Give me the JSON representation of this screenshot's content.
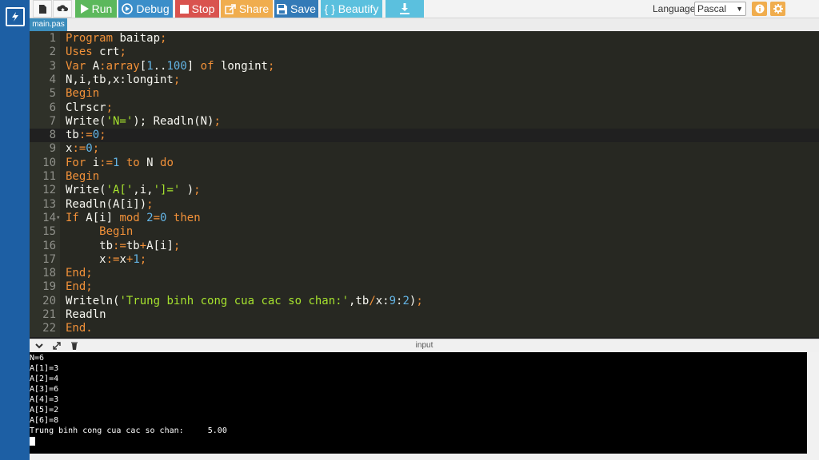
{
  "toolbar": {
    "run_label": "Run",
    "debug_label": "Debug",
    "stop_label": "Stop",
    "share_label": "Share",
    "save_label": "Save",
    "beautify_label": "{ } Beautify",
    "language_label": "Language",
    "language_value": "Pascal"
  },
  "file_tab": "main.pas",
  "editor": {
    "active_line": 8,
    "lines": [
      {
        "n": "1",
        "tokens": [
          [
            "kw",
            "Program "
          ],
          [
            "",
            "baitap"
          ],
          [
            "kw",
            ";"
          ]
        ]
      },
      {
        "n": "2",
        "tokens": [
          [
            "kw",
            "Uses "
          ],
          [
            "",
            "crt"
          ],
          [
            "kw",
            ";"
          ]
        ]
      },
      {
        "n": "3",
        "tokens": [
          [
            "kw",
            "Var "
          ],
          [
            "",
            "A"
          ],
          [
            "kw",
            ":"
          ],
          [
            "kw",
            "array"
          ],
          [
            "",
            "["
          ],
          [
            "num",
            "1"
          ],
          [
            "",
            "..",
            ""
          ],
          [
            "num",
            "100"
          ],
          [
            "",
            "] "
          ],
          [
            "kw",
            "of "
          ],
          [
            "",
            "longint"
          ],
          [
            "kw",
            ";"
          ]
        ]
      },
      {
        "n": "4",
        "tokens": [
          [
            "",
            "N,i,tb,x:longint"
          ],
          [
            "kw",
            ";"
          ]
        ]
      },
      {
        "n": "5",
        "tokens": [
          [
            "kw",
            "Begin"
          ]
        ]
      },
      {
        "n": "6",
        "tokens": [
          [
            "",
            "Clrscr"
          ],
          [
            "kw",
            ";"
          ]
        ]
      },
      {
        "n": "7",
        "tokens": [
          [
            "",
            "Write("
          ],
          [
            "str",
            "'N='"
          ],
          [
            "",
            "); Readln(N)"
          ],
          [
            "kw",
            ";"
          ]
        ]
      },
      {
        "n": "8",
        "tokens": [
          [
            "",
            "tb"
          ],
          [
            "kw",
            ":="
          ],
          [
            "num",
            "0"
          ],
          [
            "kw",
            ";"
          ]
        ]
      },
      {
        "n": "9",
        "tokens": [
          [
            "",
            "x"
          ],
          [
            "kw",
            ":="
          ],
          [
            "num",
            "0"
          ],
          [
            "kw",
            ";"
          ]
        ]
      },
      {
        "n": "10",
        "tokens": [
          [
            "kw",
            "For "
          ],
          [
            "",
            "i"
          ],
          [
            "kw",
            ":="
          ],
          [
            "num",
            "1"
          ],
          [
            "kw",
            " to "
          ],
          [
            "",
            "N "
          ],
          [
            "kw",
            "do"
          ]
        ]
      },
      {
        "n": "11",
        "tokens": [
          [
            "kw",
            "Begin"
          ]
        ]
      },
      {
        "n": "12",
        "tokens": [
          [
            "",
            "Write("
          ],
          [
            "str",
            "'A['"
          ],
          [
            "",
            ",i,"
          ],
          [
            "str",
            "']='"
          ],
          [
            "",
            " )"
          ],
          [
            "kw",
            ";"
          ]
        ]
      },
      {
        "n": "13",
        "tokens": [
          [
            "",
            "Readln(A[i])"
          ],
          [
            "kw",
            ";"
          ]
        ]
      },
      {
        "n": "14",
        "fold": true,
        "tokens": [
          [
            "kw",
            "If "
          ],
          [
            "",
            "A[i] "
          ],
          [
            "kw",
            "mod "
          ],
          [
            "num",
            "2"
          ],
          [
            "kw",
            "="
          ],
          [
            "num",
            "0"
          ],
          [
            "kw",
            " then"
          ]
        ]
      },
      {
        "n": "15",
        "tokens": [
          [
            "",
            "     "
          ],
          [
            "kw",
            "Begin"
          ]
        ]
      },
      {
        "n": "16",
        "tokens": [
          [
            "",
            "     tb"
          ],
          [
            "kw",
            ":="
          ],
          [
            "",
            "tb"
          ],
          [
            "kw",
            "+"
          ],
          [
            "",
            "A[i]"
          ],
          [
            "kw",
            ";"
          ]
        ]
      },
      {
        "n": "17",
        "tokens": [
          [
            "",
            "     x"
          ],
          [
            "kw",
            ":="
          ],
          [
            "",
            "x"
          ],
          [
            "kw",
            "+"
          ],
          [
            "num",
            "1"
          ],
          [
            "kw",
            ";"
          ]
        ]
      },
      {
        "n": "18",
        "tokens": [
          [
            "kw",
            "End"
          ],
          [
            "kw",
            ";"
          ]
        ]
      },
      {
        "n": "19",
        "tokens": [
          [
            "kw",
            "End"
          ],
          [
            "kw",
            ";"
          ]
        ]
      },
      {
        "n": "20",
        "tokens": [
          [
            "",
            "Writeln("
          ],
          [
            "str",
            "'Trung binh cong cua cac so chan:'"
          ],
          [
            "",
            ",tb"
          ],
          [
            "kw",
            "/"
          ],
          [
            "",
            "x:"
          ],
          [
            "num",
            "9"
          ],
          [
            "",
            ":"
          ],
          [
            "num",
            "2"
          ],
          [
            "",
            ")"
          ],
          [
            "kw",
            ";"
          ]
        ]
      },
      {
        "n": "21",
        "tokens": [
          [
            "",
            "Readln"
          ]
        ]
      },
      {
        "n": "22",
        "tokens": [
          [
            "kw",
            "End."
          ]
        ]
      }
    ]
  },
  "output": {
    "title": "input",
    "lines": [
      "N=6",
      "A[1]=3",
      "A[2]=4",
      "A[3]=6",
      "A[4]=3",
      "A[5]=2",
      "A[6]=8",
      "Trung binh cong cua cac so chan:     5.00"
    ]
  },
  "colors": {
    "rail": "#1d5fa4",
    "run": "#5cb85c",
    "debug": "#3b8ec9",
    "stop": "#d9534f",
    "share": "#f0ad4e",
    "save": "#337ab7",
    "beautify": "#5bc0de"
  }
}
